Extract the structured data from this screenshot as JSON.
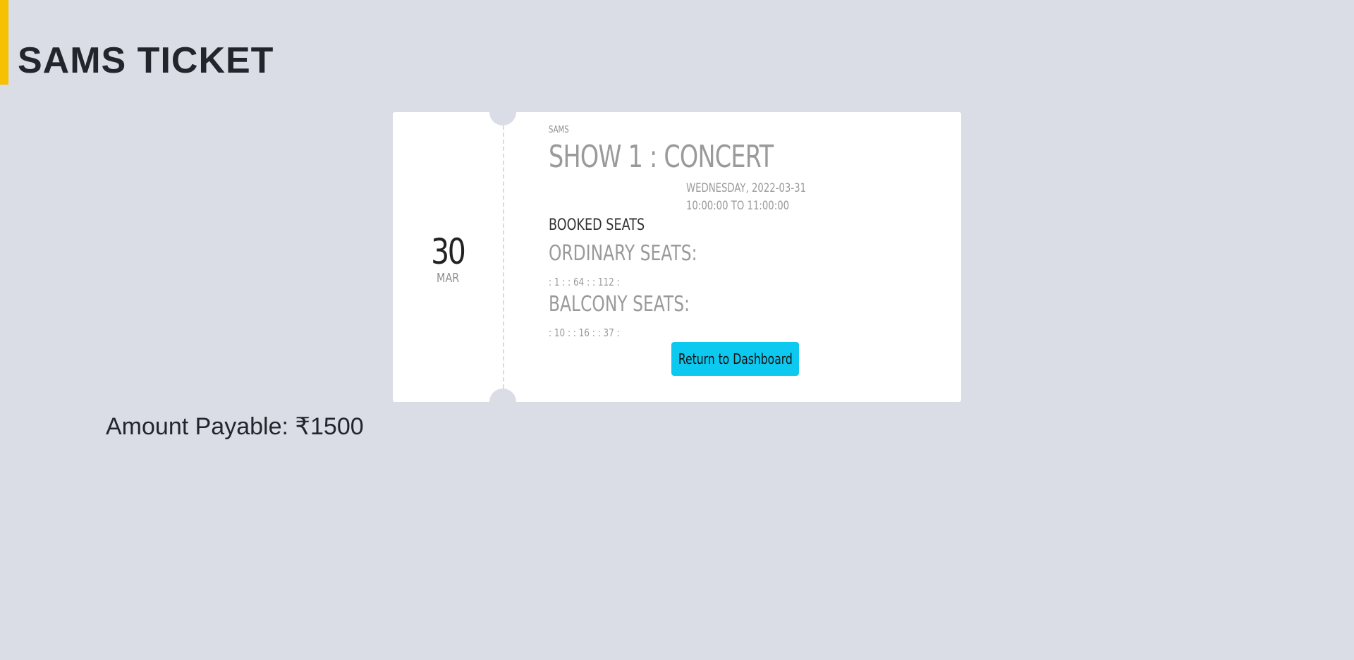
{
  "colors": {
    "background": "#dadde6",
    "accent": "#f5c100",
    "button": "#0dc8ef"
  },
  "header": {
    "title": "SAMS TICKET"
  },
  "ticket": {
    "date_day": "30",
    "date_month": "MAR",
    "brand": "SAMS",
    "show_title": "SHOW 1 : CONCERT",
    "date_line": "WEDNESDAY, 2022-03-31",
    "time_line": "10:00:00 TO 11:00:00",
    "booked_label": "BOOKED SEATS",
    "ordinary_label": "ORDINARY SEATS:",
    "ordinary_seats": ": 1 : : 64 : : 112 :",
    "balcony_label": "BALCONY SEATS:",
    "balcony_seats": ": 10 : : 16 : : 37 :",
    "button_label": "Return to Dashboard"
  },
  "amount": {
    "label": "Amount Payable: ₹1500"
  }
}
